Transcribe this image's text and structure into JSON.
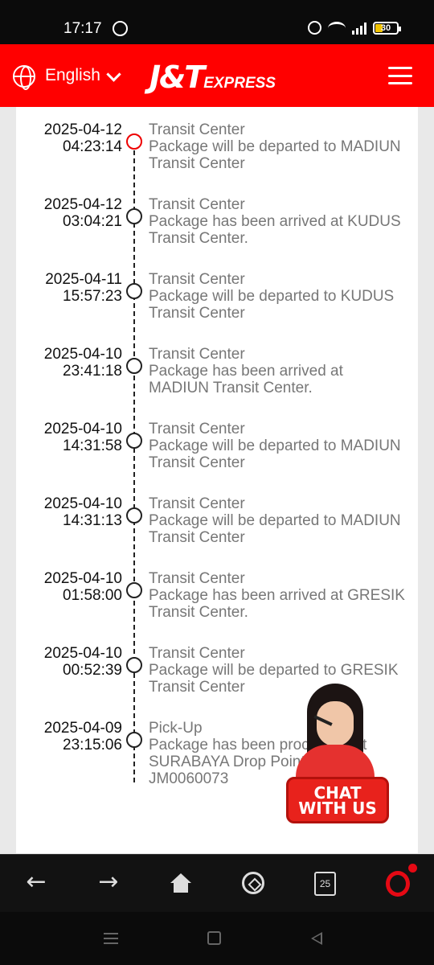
{
  "status_bar": {
    "time": "17:17",
    "battery": "30",
    "icons": [
      "whatsapp-icon",
      "alarm-icon",
      "wifi-icon",
      "signal-icon",
      "battery-icon"
    ]
  },
  "header": {
    "language": "English",
    "logo_main": "J&T",
    "logo_sub": "EXPRESS",
    "brand_color": "#ff0000"
  },
  "tracking": {
    "events": [
      {
        "date": "2025-04-12",
        "time": "04:23:14",
        "title": "Transit Center",
        "desc": "Package will be departed to MADIUN Transit Center",
        "current": true
      },
      {
        "date": "2025-04-12",
        "time": "03:04:21",
        "title": "Transit Center",
        "desc": "Package has been arrived at KUDUS Transit Center.",
        "current": false
      },
      {
        "date": "2025-04-11",
        "time": "15:57:23",
        "title": "Transit Center",
        "desc": "Package will be departed to KUDUS Transit Center",
        "current": false
      },
      {
        "date": "2025-04-10",
        "time": "23:41:18",
        "title": "Transit Center",
        "desc": "Package has been arrived at MADIUN Transit Center.",
        "current": false
      },
      {
        "date": "2025-04-10",
        "time": "14:31:58",
        "title": "Transit Center",
        "desc": "Package will be departed to MADIUN Transit Center",
        "current": false
      },
      {
        "date": "2025-04-10",
        "time": "14:31:13",
        "title": "Transit Center",
        "desc": "Package will be departed to MADIUN Transit Center",
        "current": false
      },
      {
        "date": "2025-04-10",
        "time": "01:58:00",
        "title": "Transit Center",
        "desc": "Package has been arrived at GRESIK Transit Center.",
        "current": false
      },
      {
        "date": "2025-04-10",
        "time": "00:52:39",
        "title": "Transit Center",
        "desc": "Package will be departed to GRESIK Transit Center",
        "current": false
      },
      {
        "date": "2025-04-09",
        "time": "23:15:06",
        "title": "Pick-Up",
        "desc": "Package has been processed at SURABAYA Drop Point Kali JM0060073",
        "current": false
      }
    ]
  },
  "chat": {
    "line1": "CHAT",
    "line2": "WITH US"
  },
  "browser_bar": {
    "tabs_count": "25",
    "icons": [
      "back-arrow-icon",
      "forward-arrow-icon",
      "home-icon",
      "football-icon",
      "tabs-icon",
      "opera-icon"
    ]
  },
  "system_nav": {
    "icons": [
      "recent-apps-icon",
      "home-button-icon",
      "back-button-icon"
    ]
  }
}
